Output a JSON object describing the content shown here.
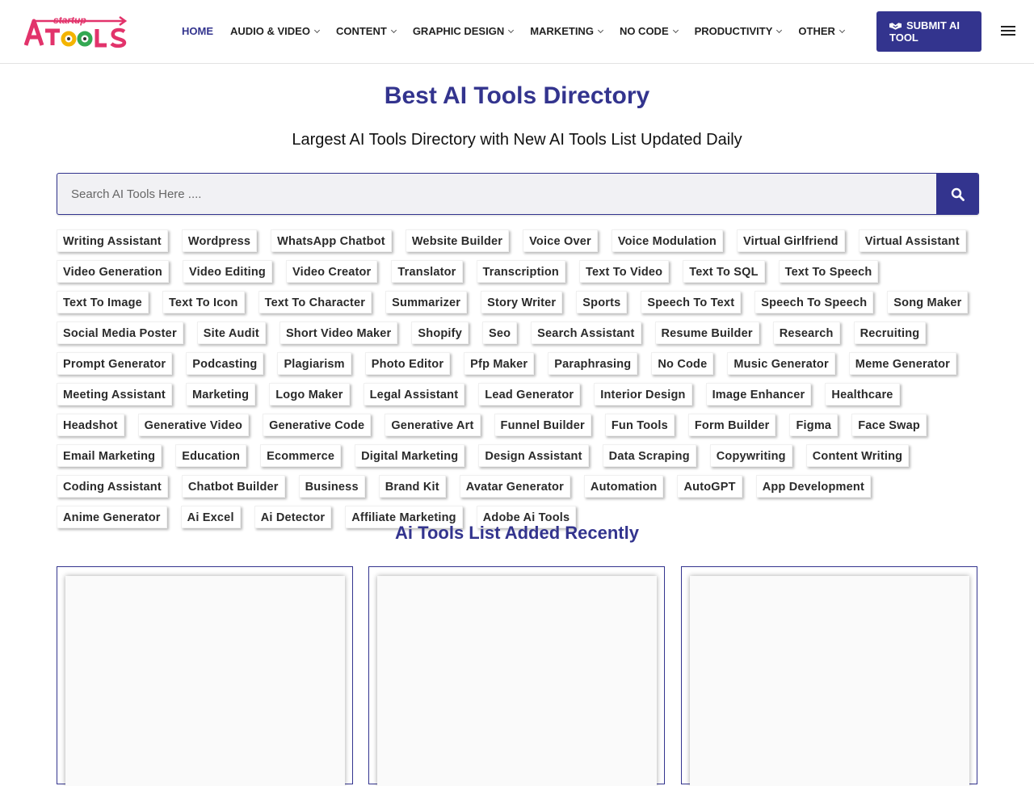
{
  "header": {
    "logo": {
      "small_text": "startup",
      "main_text": "AI TOOLS"
    },
    "nav": [
      {
        "label": "HOME",
        "active": true,
        "dropdown": false
      },
      {
        "label": "AUDIO & VIDEO",
        "active": false,
        "dropdown": true
      },
      {
        "label": "CONTENT",
        "active": false,
        "dropdown": true
      },
      {
        "label": "GRAPHIC DESIGN",
        "active": false,
        "dropdown": true
      },
      {
        "label": "MARKETING",
        "active": false,
        "dropdown": true
      },
      {
        "label": "NO CODE",
        "active": false,
        "dropdown": true
      },
      {
        "label": "PRODUCTIVITY",
        "active": false,
        "dropdown": true
      },
      {
        "label": "OTHER",
        "active": false,
        "dropdown": true
      }
    ],
    "submit_label": "SUBMIT AI TOOL",
    "submit_icon": "handshake-icon",
    "menu_icon": "hamburger-menu-icon"
  },
  "hero": {
    "title": "Best AI Tools Directory",
    "subtitle": "Largest AI Tools Directory with New AI Tools List Updated Daily"
  },
  "search": {
    "placeholder": "Search AI Tools Here ....",
    "value": "",
    "icon": "search-icon"
  },
  "tags": [
    "Writing Assistant",
    "Wordpress",
    "WhatsApp Chatbot",
    "Website Builder",
    "Voice Over",
    "Voice Modulation",
    "Virtual Girlfriend",
    "Virtual Assistant",
    "Video Generation",
    "Video Editing",
    "Video Creator",
    "Translator",
    "Transcription",
    "Text To Video",
    "Text To SQL",
    "Text To Speech",
    "Text To Image",
    "Text To Icon",
    "Text To Character",
    "Summarizer",
    "Story Writer",
    "Sports",
    "Speech To Text",
    "Speech To Speech",
    "Song Maker",
    "Social Media Poster",
    "Site Audit",
    "Short Video Maker",
    "Shopify",
    "Seo",
    "Search Assistant",
    "Resume Builder",
    "Research",
    "Recruiting",
    "Prompt Generator",
    "Podcasting",
    "Plagiarism",
    "Photo Editor",
    "Pfp Maker",
    "Paraphrasing",
    "No Code",
    "Music Generator",
    "Meme Generator",
    "Meeting Assistant",
    "Marketing",
    "Logo Maker",
    "Legal Assistant",
    "Lead Generator",
    "Interior Design",
    "Image Enhancer",
    "Healthcare",
    "Headshot",
    "Generative Video",
    "Generative Code",
    "Generative Art",
    "Funnel Builder",
    "Fun Tools",
    "Form Builder",
    "Figma",
    "Face Swap",
    "Email Marketing",
    "Education",
    "Ecommerce",
    "Digital Marketing",
    "Design Assistant",
    "Data Scraping",
    "Copywriting",
    "Content Writing",
    "Coding Assistant",
    "Chatbot Builder",
    "Business",
    "Brand Kit",
    "Avatar Generator",
    "Automation",
    "AutoGPT",
    "App Development",
    "Anime Generator",
    "Ai Excel",
    "Ai Detector",
    "Affiliate Marketing",
    "Adobe Ai Tools"
  ],
  "recent": {
    "title": "Ai Tools List Added Recently",
    "card_count": 3
  },
  "colors": {
    "accent": "#33348e",
    "logo_pink": "#e2336b"
  }
}
